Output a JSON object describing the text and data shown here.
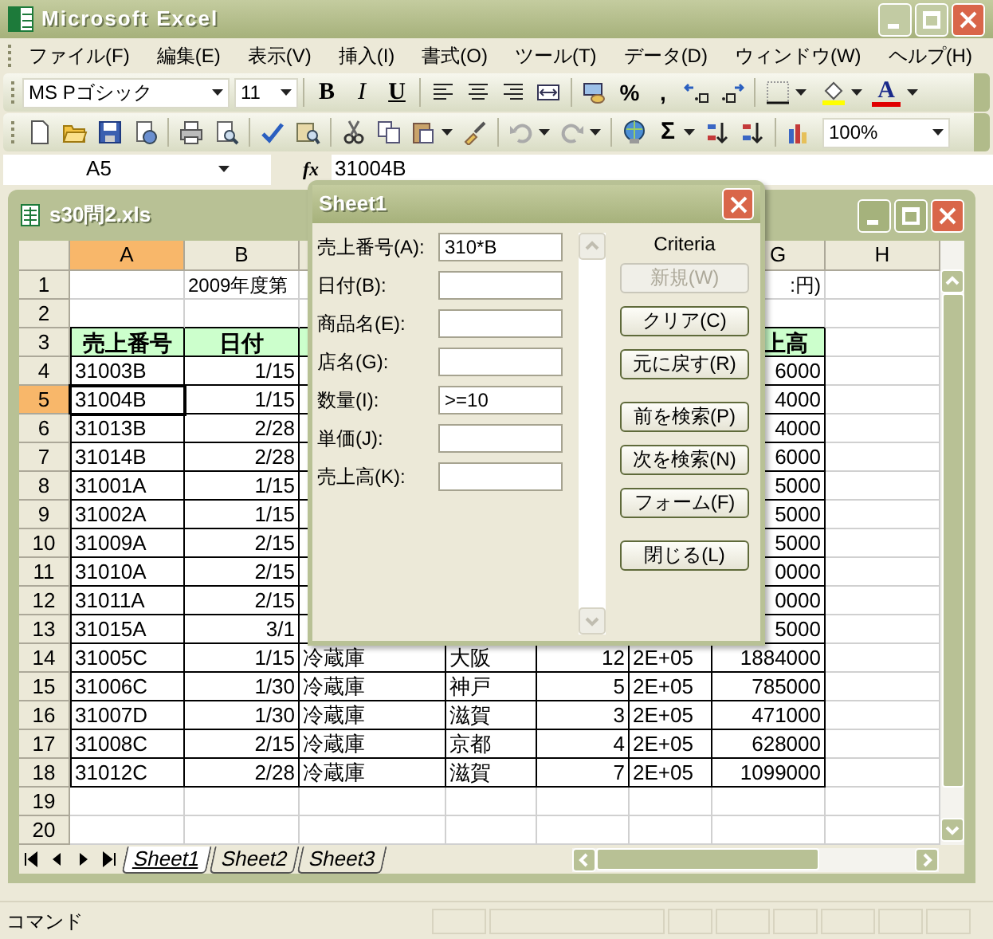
{
  "window": {
    "title": "Microsoft Excel"
  },
  "menu": [
    "ファイル(F)",
    "編集(E)",
    "表示(V)",
    "挿入(I)",
    "書式(O)",
    "ツール(T)",
    "データ(D)",
    "ウィンドウ(W)",
    "ヘルプ(H)"
  ],
  "formatting_toolbar": {
    "font": "MS Pゴシック",
    "size": "11",
    "style_buttons": [
      "B",
      "I",
      "U"
    ],
    "percent": "%",
    "comma": ",",
    "font_color": "A"
  },
  "standard_toolbar": {
    "sum": "Σ",
    "zoom": "100%"
  },
  "formula_bar": {
    "name_box": "A5",
    "function_label": "fx",
    "formula": "31004B"
  },
  "workbook": {
    "title": "s30問2.xls",
    "columns": {
      "A": {
        "label": "A",
        "selected": true
      },
      "B": {
        "label": "B",
        "selected": false
      },
      "G": {
        "label": "G",
        "selected": false
      },
      "H": {
        "label": "H",
        "selected": false
      }
    },
    "rows": [
      {
        "header": "1",
        "kind": "title",
        "selected": false,
        "cells": {
          "B": "2009年度第",
          "G": ":円)"
        }
      },
      {
        "header": "2",
        "kind": "blank",
        "selected": false,
        "cells": {}
      },
      {
        "header": "3",
        "kind": "header",
        "selected": false,
        "cells": {
          "A": "売上番号",
          "B": "日付",
          "G": "上高"
        }
      },
      {
        "header": "4",
        "kind": "data",
        "selected": false,
        "cells": {
          "A": "31003B",
          "B": "1/15",
          "G": "6000"
        }
      },
      {
        "header": "5",
        "kind": "data",
        "selected": true,
        "cells": {
          "A": "31004B",
          "B": "1/15",
          "G": "4000"
        }
      },
      {
        "header": "6",
        "kind": "data",
        "selected": false,
        "cells": {
          "A": "31013B",
          "B": "2/28",
          "G": "4000"
        }
      },
      {
        "header": "7",
        "kind": "data",
        "selected": false,
        "cells": {
          "A": "31014B",
          "B": "2/28",
          "G": "6000"
        }
      },
      {
        "header": "8",
        "kind": "data",
        "selected": false,
        "cells": {
          "A": "31001A",
          "B": "1/15",
          "G": "5000"
        }
      },
      {
        "header": "9",
        "kind": "data",
        "selected": false,
        "cells": {
          "A": "31002A",
          "B": "1/15",
          "G": "5000"
        }
      },
      {
        "header": "10",
        "kind": "data",
        "selected": false,
        "cells": {
          "A": "31009A",
          "B": "2/15",
          "G": "5000"
        }
      },
      {
        "header": "11",
        "kind": "data",
        "selected": false,
        "cells": {
          "A": "31010A",
          "B": "2/15",
          "G": "0000"
        }
      },
      {
        "header": "12",
        "kind": "data",
        "selected": false,
        "cells": {
          "A": "31011A",
          "B": "2/15",
          "G": "0000"
        }
      },
      {
        "header": "13",
        "kind": "data",
        "selected": false,
        "cells": {
          "A": "31015A",
          "B": "3/1",
          "G": "5000"
        }
      },
      {
        "header": "14",
        "kind": "data",
        "selected": false,
        "cells": {
          "A": "31005C",
          "B": "1/15",
          "C": "冷蔵庫",
          "D": "大阪",
          "E": "12",
          "F": "2E+05",
          "G": "1884000"
        }
      },
      {
        "header": "15",
        "kind": "data",
        "selected": false,
        "cells": {
          "A": "31006C",
          "B": "1/30",
          "C": "冷蔵庫",
          "D": "神戸",
          "E": "5",
          "F": "2E+05",
          "G": "785000"
        }
      },
      {
        "header": "16",
        "kind": "data",
        "selected": false,
        "cells": {
          "A": "31007D",
          "B": "1/30",
          "C": "冷蔵庫",
          "D": "滋賀",
          "E": "3",
          "F": "2E+05",
          "G": "471000"
        }
      },
      {
        "header": "17",
        "kind": "data",
        "selected": false,
        "cells": {
          "A": "31008C",
          "B": "2/15",
          "C": "冷蔵庫",
          "D": "京都",
          "E": "4",
          "F": "2E+05",
          "G": "628000"
        }
      },
      {
        "header": "18",
        "kind": "data",
        "selected": false,
        "cells": {
          "A": "31012C",
          "B": "2/28",
          "C": "冷蔵庫",
          "D": "滋賀",
          "E": "7",
          "F": "2E+05",
          "G": "1099000"
        }
      },
      {
        "header": "19",
        "kind": "blank",
        "selected": false,
        "cells": {}
      },
      {
        "header": "20",
        "kind": "blank",
        "selected": false,
        "cells": {}
      }
    ]
  },
  "sheet_tabs": [
    {
      "label": "Sheet1",
      "selected": true
    },
    {
      "label": "Sheet2",
      "selected": false
    },
    {
      "label": "Sheet3",
      "selected": false
    }
  ],
  "dialog": {
    "title": "Sheet1",
    "criteria_label": "Criteria",
    "fields": [
      {
        "label": "売上番号(A):",
        "value": "310*B"
      },
      {
        "label": "日付(B):"
      },
      {
        "label": "商品名(E):"
      },
      {
        "label": "店名(G):"
      },
      {
        "label": "数量(I):",
        "value": ">=10"
      },
      {
        "label": "単価(J):"
      },
      {
        "label": "売上高(K):"
      }
    ],
    "button_groups": [
      [
        {
          "label": "新規(W)",
          "disabled": true
        },
        {
          "label": "クリア(C)",
          "disabled": false
        },
        {
          "label": "元に戻す(R)",
          "disabled": false
        }
      ],
      [
        {
          "label": "前を検索(P)",
          "disabled": false
        },
        {
          "label": "次を検索(N)",
          "disabled": false
        },
        {
          "label": "フォーム(F)",
          "disabled": false
        }
      ],
      [
        {
          "label": "閉じる(L)",
          "disabled": false
        }
      ]
    ]
  },
  "status_bar": {
    "text": "コマンド"
  }
}
